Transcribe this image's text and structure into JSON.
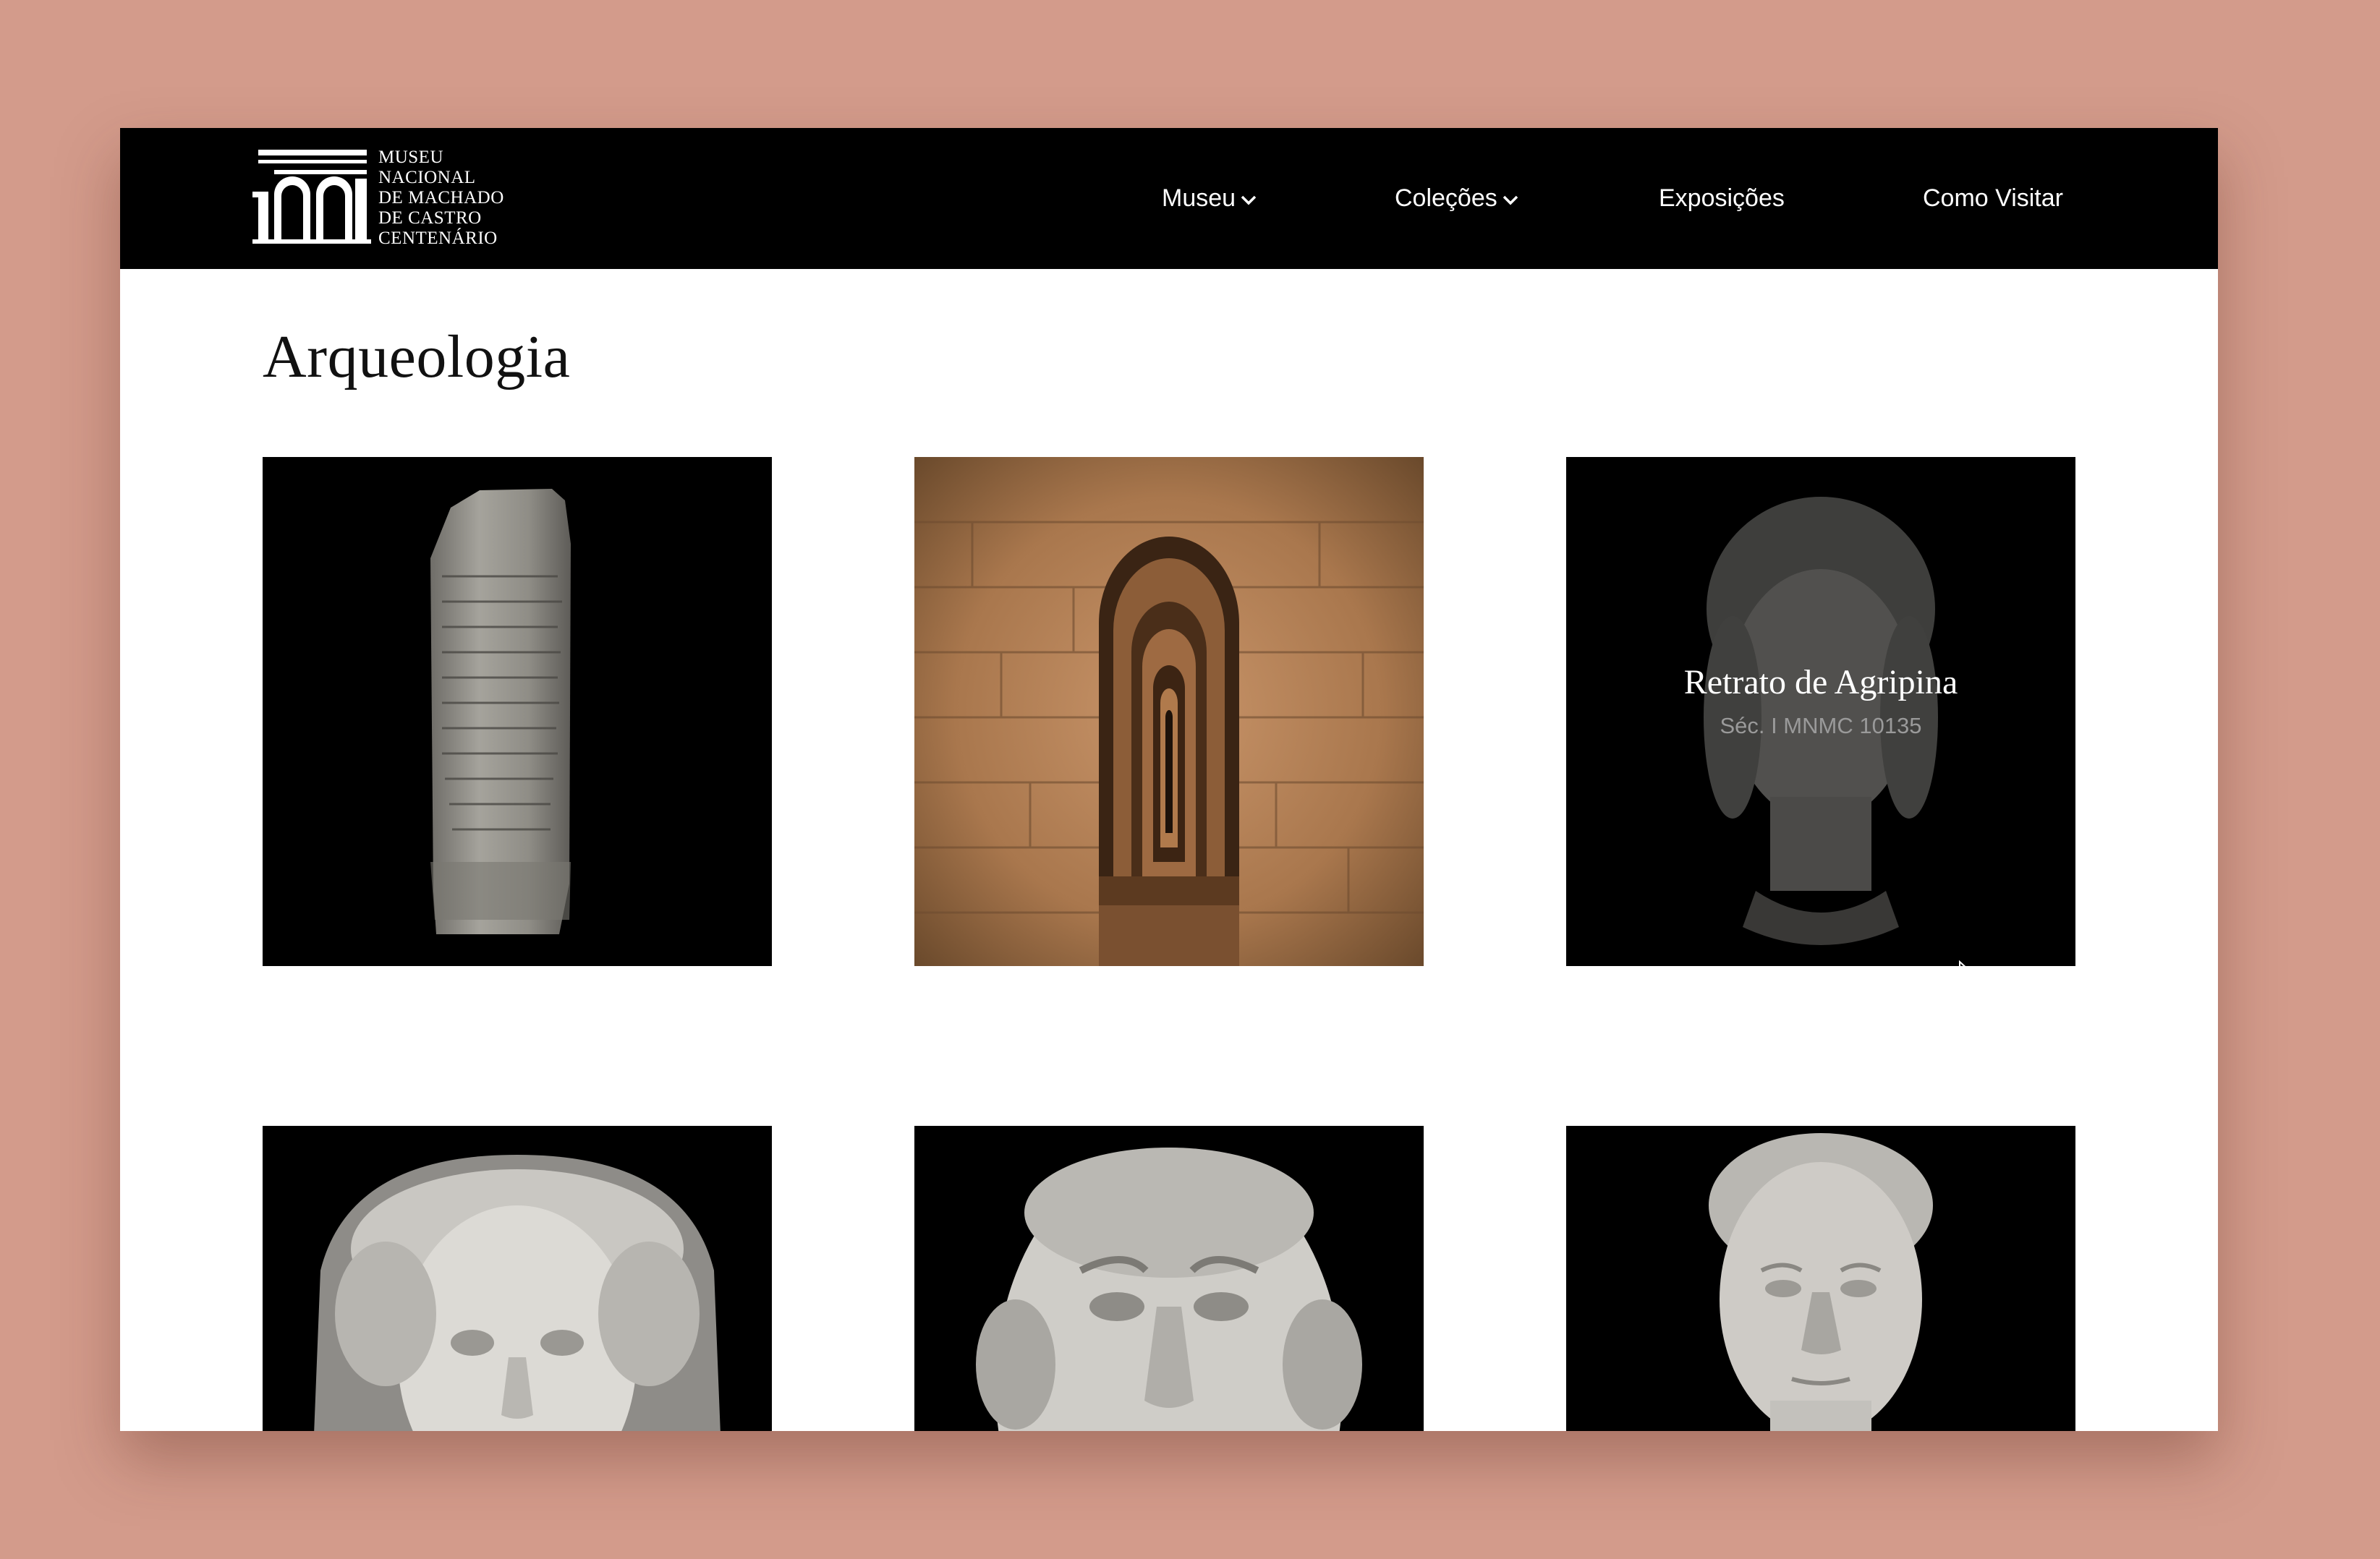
{
  "brand": {
    "logo_number": "100",
    "logo_lines": [
      "MUSEU",
      "NACIONAL",
      "DE MACHADO",
      "DE CASTRO",
      "CENTENÁRIO"
    ]
  },
  "nav": {
    "items": [
      {
        "label": "Museu",
        "has_dropdown": true
      },
      {
        "label": "Coleções",
        "has_dropdown": true
      },
      {
        "label": "Exposições",
        "has_dropdown": false
      },
      {
        "label": "Como Visitar",
        "has_dropdown": false
      }
    ]
  },
  "page": {
    "title": "Arqueologia"
  },
  "gallery": {
    "items": [
      {
        "name": "inscribed-stone-stele",
        "image": "inscribed-stone-stele"
      },
      {
        "name": "cryptoporticus-arches",
        "image": "cryptoporticus-arches"
      },
      {
        "name": "retrato-de-agripina",
        "image": "marble-head-agripina",
        "title": "Retrato de Agripina",
        "subtitle": "Séc. I MNMC 10135",
        "hovered": true
      },
      {
        "name": "veiled-female-head",
        "image": "veiled-female-head"
      },
      {
        "name": "male-portrait-head",
        "image": "male-portrait-head"
      },
      {
        "name": "young-male-head",
        "image": "young-male-head"
      }
    ]
  },
  "colors": {
    "backdrop": "#d39b8b",
    "header_bg": "#000000",
    "header_text": "#ffffff",
    "caption_sub": "#9a9a9a"
  }
}
